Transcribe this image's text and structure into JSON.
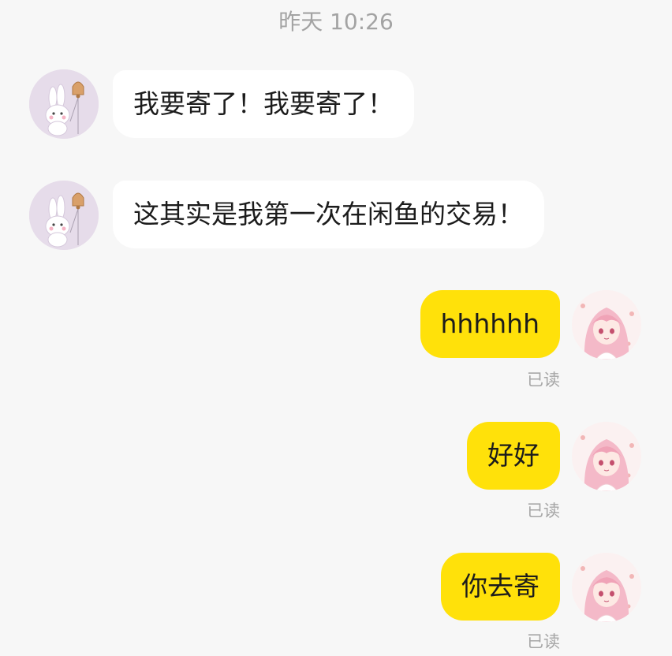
{
  "header": {
    "timestamp": "昨天 10:26"
  },
  "messages": [
    {
      "side": "peer",
      "text": "我要寄了！我要寄了！"
    },
    {
      "side": "peer",
      "text": "这其实是我第一次在闲鱼的交易！"
    },
    {
      "side": "me",
      "text": "hhhhhh",
      "status": "已读"
    },
    {
      "side": "me",
      "text": "好好",
      "status": "已读"
    },
    {
      "side": "me",
      "text": "你去寄",
      "status": "已读"
    }
  ],
  "icons": {
    "peer_avatar": "bunny-with-bell-avatar",
    "self_avatar": "pink-hair-anime-girl-avatar"
  },
  "colors": {
    "background": "#f7f7f7",
    "incoming_bubble": "#ffffff",
    "outgoing_bubble": "#ffe10a",
    "timestamp_text": "#a3a3a3",
    "read_status_text": "#a6a6a6"
  }
}
